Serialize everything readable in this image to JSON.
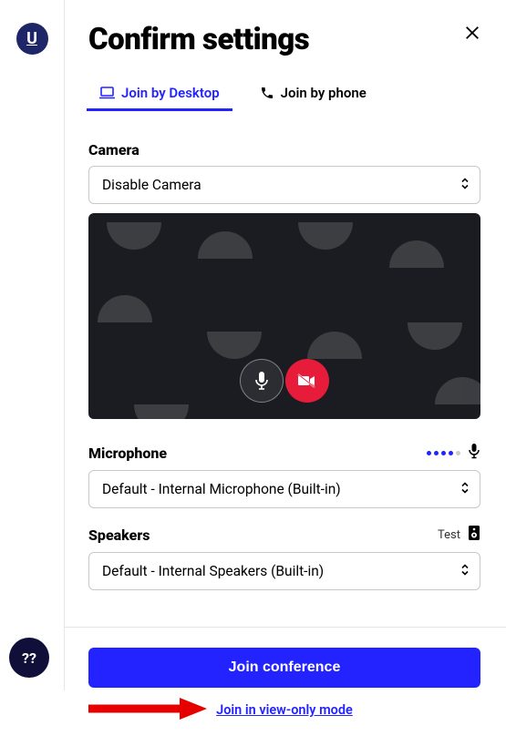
{
  "logo": "U",
  "title": "Confirm settings",
  "tabs": {
    "desktop": "Join by Desktop",
    "phone": "Join by phone"
  },
  "camera": {
    "label": "Camera",
    "value": "Disable Camera"
  },
  "microphone": {
    "label": "Microphone",
    "value": "Default - Internal Microphone (Built-in)"
  },
  "speakers": {
    "label": "Speakers",
    "test": "Test",
    "value": "Default - Internal Speakers (Built-in)"
  },
  "buttons": {
    "join": "Join conference",
    "viewOnly": "Join in view-only mode"
  },
  "help": "??"
}
